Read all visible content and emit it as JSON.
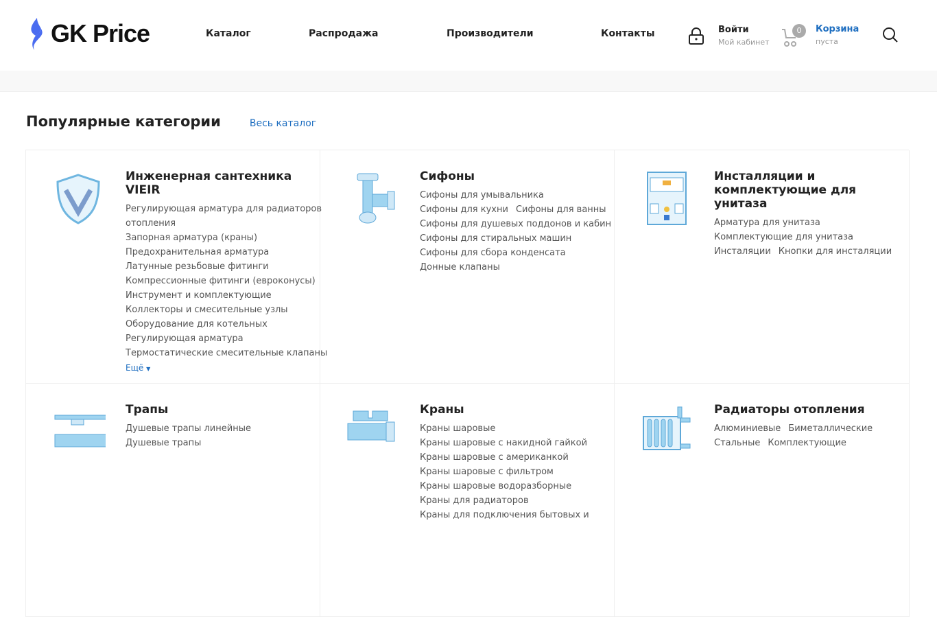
{
  "header": {
    "logo": "GK Price",
    "nav": [
      "Каталог",
      "Распродажа",
      "Производители",
      "Контакты"
    ],
    "login": {
      "title": "Войти",
      "subtitle": "Мой кабинет"
    },
    "cart": {
      "count": "0",
      "title": "Корзина",
      "subtitle": "пуста"
    }
  },
  "section": {
    "title": "Популярные категории",
    "all_link": "Весь каталог"
  },
  "categories": [
    {
      "title": "Инженерная сантехника VIEIR",
      "lines": [
        [
          "Регулирующая арматура для радиаторов"
        ],
        [
          "отопления"
        ],
        [
          "Запорная арматура (краны)"
        ],
        [
          "Предохранительная арматура"
        ],
        [
          "Латунные резьбовые фитинги"
        ],
        [
          "Компрессионные фитинги (евроконусы)"
        ],
        [
          "Инструмент и комплектующие"
        ],
        [
          "Коллекторы и смесительные узлы"
        ],
        [
          "Оборудование для котельных"
        ],
        [
          "Регулирующая арматура"
        ],
        [
          "Термостатические смесительные клапаны"
        ]
      ],
      "more": "Ещё"
    },
    {
      "title": "Сифоны",
      "lines": [
        [
          "Сифоны для умывальника"
        ],
        [
          "Сифоны для кухни",
          "Сифоны для ванны"
        ],
        [
          "Сифоны для душевых поддонов и кабин"
        ],
        [
          "Сифоны для стиральных машин"
        ],
        [
          "Сифоны для сбора конденсата"
        ],
        [
          "Донные клапаны"
        ]
      ]
    },
    {
      "title": "Инсталляции и комплектующие для унитаза",
      "lines": [
        [
          "Арматура для унитаза"
        ],
        [
          "Комплектующие для унитаза"
        ],
        [
          "Инсталяции",
          "Кнопки для инсталяции"
        ]
      ]
    },
    {
      "title": "Трапы",
      "lines": [
        [
          "Душевые трапы линейные"
        ],
        [
          "Душевые трапы"
        ]
      ]
    },
    {
      "title": "Краны",
      "lines": [
        [
          "Краны шаровые"
        ],
        [
          "Краны шаровые с накидной гайкой"
        ],
        [
          "Краны шаровые с американкой"
        ],
        [
          "Краны шаровые с фильтром"
        ],
        [
          "Краны шаровые водоразборные"
        ],
        [
          "Краны для радиаторов"
        ],
        [
          "Краны для подключения бытовых и"
        ]
      ]
    },
    {
      "title": "Радиаторы отопления",
      "lines": [
        [
          "Алюминиевые",
          "Биметаллические"
        ],
        [
          "Стальные",
          "Комплектующие"
        ]
      ]
    }
  ],
  "colors": {
    "accent": "#1e6ec0",
    "icon_blue": "#9fd4f0"
  }
}
